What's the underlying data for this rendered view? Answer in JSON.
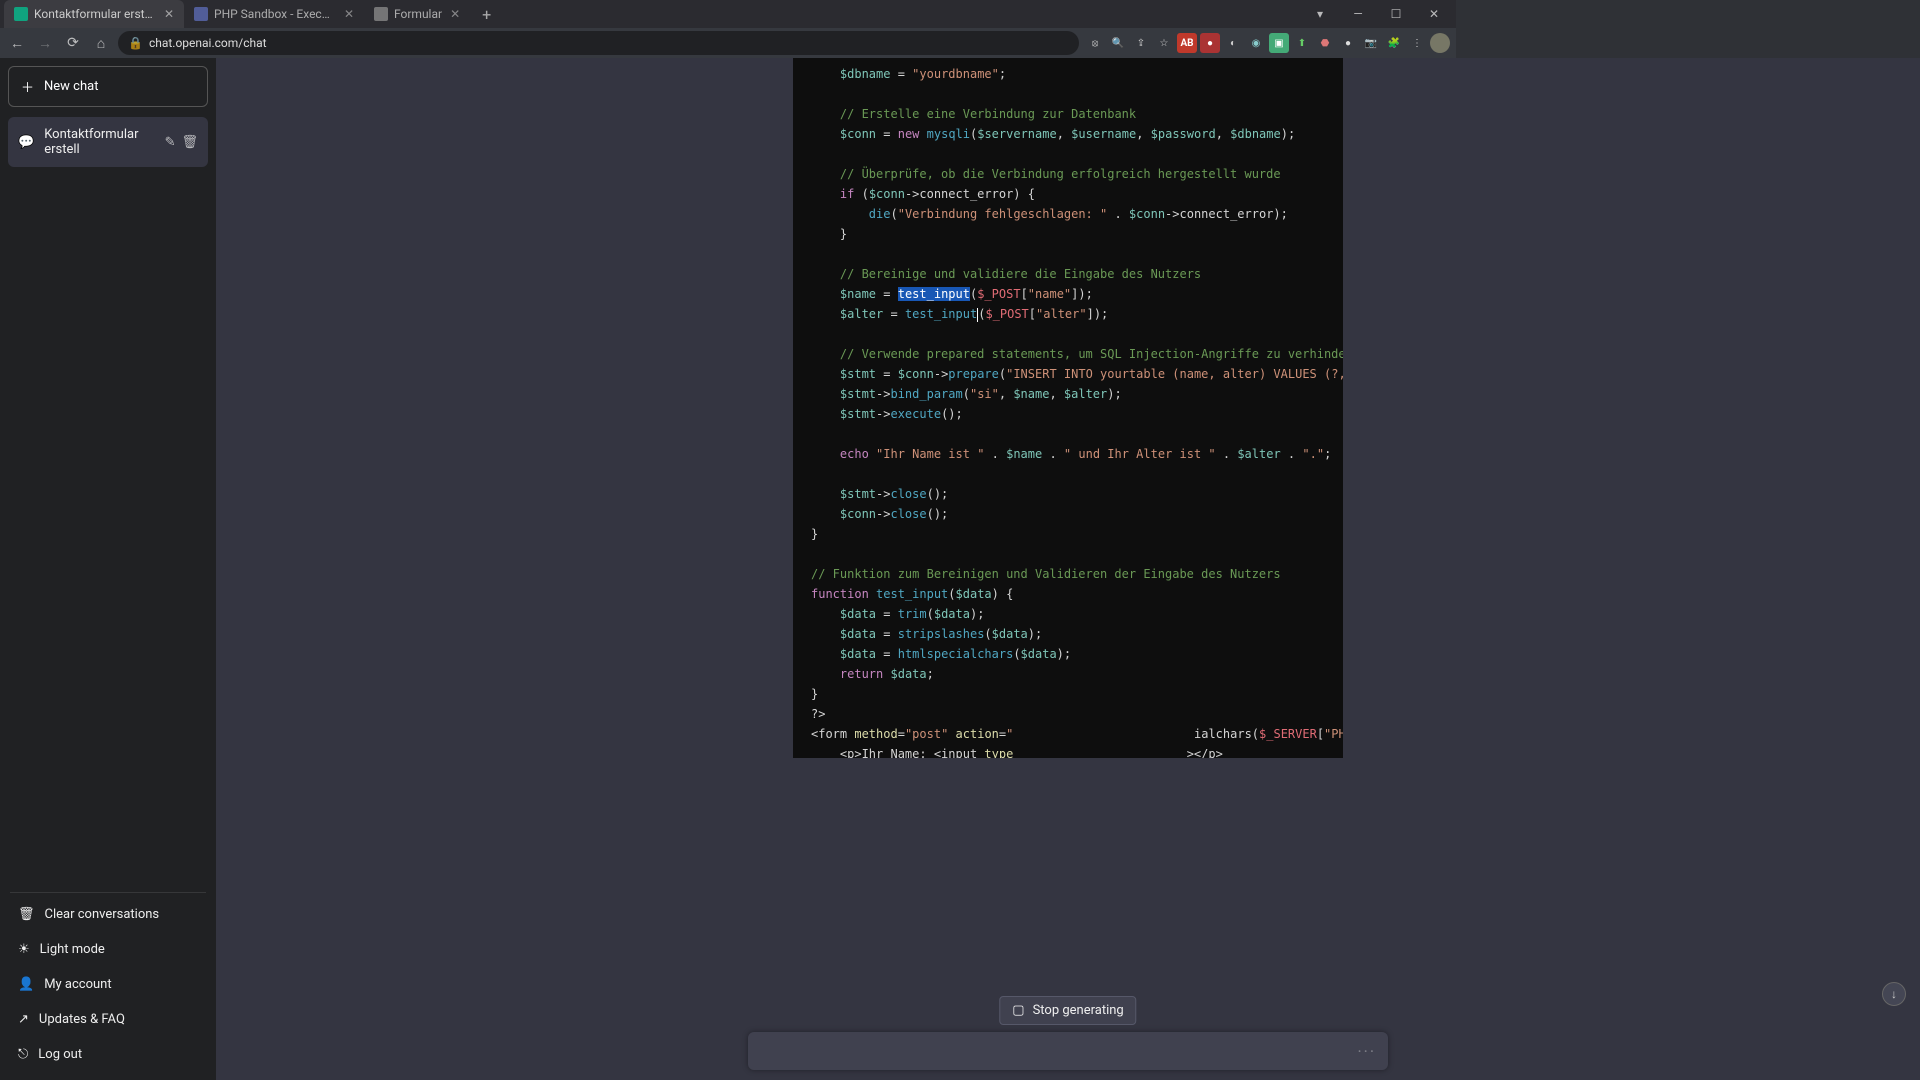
{
  "tabs": [
    {
      "label": "Kontaktformular erstellen.",
      "active": true,
      "fav_bg": "#10a37f"
    },
    {
      "label": "PHP Sandbox - Execute PHP cod",
      "active": false,
      "fav_bg": "#5b6ab3"
    },
    {
      "label": "Formular",
      "active": false,
      "fav_bg": "#888"
    }
  ],
  "url": "chat.openai.com/chat",
  "sidebar": {
    "new_chat": "New chat",
    "conversation": "Kontaktformular erstell",
    "items": {
      "clear": "Clear conversations",
      "light": "Light mode",
      "account": "My account",
      "updates": "Updates & FAQ",
      "logout": "Log out"
    }
  },
  "stop_generating": "Stop generating",
  "chart_data": null,
  "code_lines": [
    {
      "raw": "$dbname = \"yourdbname\";",
      "html": "<span class='tk-var'>$dbname</span> = <span class='tk-str'>\"yourdbname\"</span>;"
    },
    {
      "raw": ""
    },
    {
      "raw": "// Erstelle eine Verbindung zur Datenbank",
      "html": "<span class='tk-comment'>// Erstelle eine Verbindung zur Datenbank</span>"
    },
    {
      "raw": "$conn = new mysqli($servername, $username, $password, $dbname);",
      "html": "<span class='tk-var'>$conn</span> = <span class='tk-kw'>new</span> <span class='tk-func'>mysqli</span>(<span class='tk-var'>$servername</span>, <span class='tk-var'>$username</span>, <span class='tk-var'>$password</span>, <span class='tk-var'>$dbname</span>);"
    },
    {
      "raw": ""
    },
    {
      "raw": "// Überprüfe, ob die Verbindung erfolgreich hergestellt wurde",
      "html": "<span class='tk-comment'>// Überprüfe, ob die Verbindung erfolgreich hergestellt wurde</span>"
    },
    {
      "raw": "if ($conn->connect_error) {",
      "html": "<span class='tk-kw'>if</span> (<span class='tk-var'>$conn</span>-&gt;connect_error) {"
    },
    {
      "raw": "    die(\"Verbindung fehlgeschlagen: \" . $conn->connect_error);",
      "html": "    <span class='tk-func'>die</span>(<span class='tk-str'>\"Verbindung fehlgeschlagen: \"</span> . <span class='tk-var'>$conn</span>-&gt;connect_error);"
    },
    {
      "raw": "}",
      "html": "}"
    },
    {
      "raw": ""
    },
    {
      "raw": "// Bereinige und validiere die Eingabe des Nutzers",
      "html": "<span class='tk-comment'>// Bereinige und validiere die Eingabe des Nutzers</span>"
    },
    {
      "raw": "$name = test_input($_POST[\"name\"]);",
      "html": "<span class='tk-var'>$name</span> = <span class='hl'>test_input</span>(<span class='tk-global'>$_POST</span>[<span class='tk-str'>\"name\"</span>]);"
    },
    {
      "raw": "$alter = test_input($_POST[\"alter\"]);",
      "html": "<span class='tk-var'>$alter</span> = <span class='tk-func'>test_input</span><span class='cursor'></span>(<span class='tk-global'>$_POST</span>[<span class='tk-str'>\"alter\"</span>]);"
    },
    {
      "raw": ""
    },
    {
      "raw": "// Verwende prepared statements, um SQL Injection-Angriffe zu verhindern",
      "html": "<span class='tk-comment'>// Verwende prepared statements, um SQL Injection-Angriffe zu verhindern</span>"
    },
    {
      "raw": "$stmt = $conn->prepare(\"INSERT INTO yourtable (name, alter) VALUES (?, ?)\")",
      "html": "<span class='tk-var'>$stmt</span> = <span class='tk-var'>$conn</span>-&gt;<span class='tk-func'>prepare</span>(<span class='tk-str'>\"INSERT INTO yourtable (name, alter) VALUES (?, ?)\"</span>)"
    },
    {
      "raw": "$stmt->bind_param(\"si\", $name, $alter);",
      "html": "<span class='tk-var'>$stmt</span>-&gt;<span class='tk-func'>bind_param</span>(<span class='tk-str'>\"si\"</span>, <span class='tk-var'>$name</span>, <span class='tk-var'>$alter</span>);"
    },
    {
      "raw": "$stmt->execute();",
      "html": "<span class='tk-var'>$stmt</span>-&gt;<span class='tk-func'>execute</span>();"
    },
    {
      "raw": ""
    },
    {
      "raw": "echo \"Ihr Name ist \" . $name . \" und Ihr Alter ist \" . $alter . \".\";",
      "html": "<span class='tk-kw'>echo</span> <span class='tk-str'>\"Ihr Name ist \"</span> . <span class='tk-var'>$name</span> . <span class='tk-str'>\" und Ihr Alter ist \"</span> . <span class='tk-var'>$alter</span> . <span class='tk-str'>\".\"</span>;"
    },
    {
      "raw": ""
    },
    {
      "raw": "$stmt->close();",
      "html": "<span class='tk-var'>$stmt</span>-&gt;<span class='tk-func'>close</span>();"
    },
    {
      "raw": "$conn->close();",
      "html": "<span class='tk-var'>$conn</span>-&gt;<span class='tk-func'>close</span>();"
    },
    {
      "raw": "}",
      "html_indent": -1,
      "html": "}"
    },
    {
      "raw": ""
    },
    {
      "raw": "// Funktion zum Bereinigen und Validieren der Eingabe des Nutzers",
      "html_indent": -1,
      "html": "<span class='tk-comment'>// Funktion zum Bereinigen und Validieren der Eingabe des Nutzers</span>"
    },
    {
      "raw": "function test_input($data) {",
      "html_indent": -1,
      "html": "<span class='tk-kw'>function</span> <span class='tk-func'>test_input</span>(<span class='tk-var'>$data</span>) {"
    },
    {
      "raw": "$data = trim($data);",
      "html": "<span class='tk-var'>$data</span> = <span class='tk-func'>trim</span>(<span class='tk-var'>$data</span>);"
    },
    {
      "raw": "$data = stripslashes($data);",
      "html": "<span class='tk-var'>$data</span> = <span class='tk-func'>stripslashes</span>(<span class='tk-var'>$data</span>);"
    },
    {
      "raw": "$data = htmlspecialchars($data);",
      "html": "<span class='tk-var'>$data</span> = <span class='tk-func'>htmlspecialchars</span>(<span class='tk-var'>$data</span>);"
    },
    {
      "raw": "return $data;",
      "html": "<span class='tk-kw'>return</span> <span class='tk-var'>$data</span>;"
    },
    {
      "raw": "}",
      "html_indent": -1,
      "html": "}"
    },
    {
      "raw": "?>",
      "html_indent": -1,
      "html": "?&gt;"
    },
    {
      "raw": "<form method=\"post\" action=\"                         ialchars($_SERVER[\"PHP_SELF\"]);",
      "html_indent": -1,
      "html": "&lt;form <span class='tk-prop'>method</span>=<span class='tk-str'>\"post\"</span> <span class='tk-prop'>action</span>=<span class='tk-str'>\"</span>                         ialchars(<span class='tk-global'>$_SERVER</span>[<span class='tk-str'>\"PHP_SELF\"</span>]);"
    },
    {
      "raw": "    <p>Ihr Name: <input type                        ></p>",
      "html_indent": -1,
      "html": "    &lt;p&gt;Ihr Name: &lt;input <span class='tk-prop'>type</span>                        &gt;&lt;/p&gt;"
    }
  ]
}
